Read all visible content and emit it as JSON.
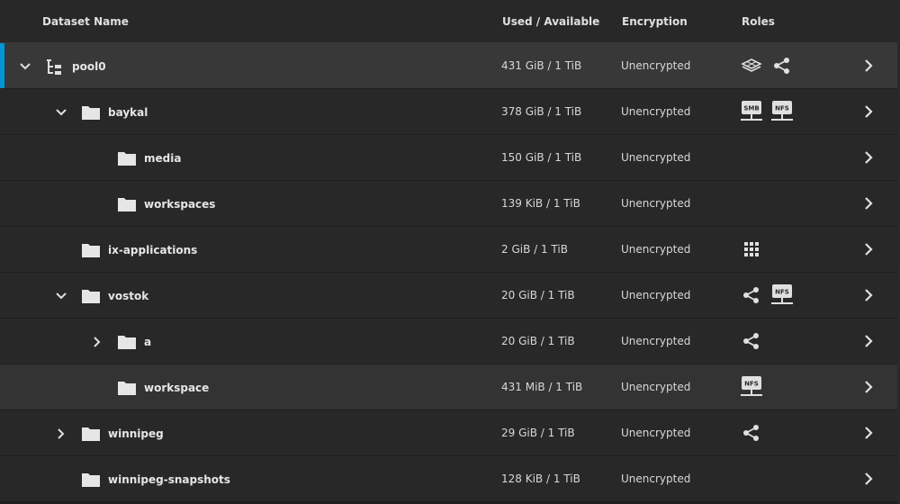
{
  "header": {
    "name": "Dataset Name",
    "used": "Used / Available",
    "encryption": "Encryption",
    "roles": "Roles"
  },
  "colors": {
    "accent": "#0095d5",
    "row": "#282828",
    "selected": "#383838",
    "icon": "#e0e0e0"
  },
  "rows": [
    {
      "name": "pool0",
      "used": "431 GiB / 1 TiB",
      "encryption": "Unencrypted",
      "toggle": "expanded",
      "icon": "pool-icon",
      "roles": [
        "stack-icon",
        "share-icon"
      ],
      "selected": true
    },
    {
      "name": "baykal",
      "used": "378 GiB / 1 TiB",
      "encryption": "Unencrypted",
      "toggle": "expanded",
      "icon": "folder-icon",
      "roles": [
        "smb-share-icon",
        "nfs-share-icon"
      ],
      "smb": "SMB",
      "nfs": "NFS"
    },
    {
      "name": "media",
      "used": "150 GiB / 1 TiB",
      "encryption": "Unencrypted",
      "toggle": "none",
      "icon": "folder-icon",
      "roles": []
    },
    {
      "name": "workspaces",
      "used": "139 KiB / 1 TiB",
      "encryption": "Unencrypted",
      "toggle": "none",
      "icon": "folder-icon",
      "roles": []
    },
    {
      "name": "ix-applications",
      "used": "2 GiB / 1 TiB",
      "encryption": "Unencrypted",
      "toggle": "none",
      "icon": "folder-icon",
      "roles": [
        "apps-icon"
      ]
    },
    {
      "name": "vostok",
      "used": "20 GiB / 1 TiB",
      "encryption": "Unencrypted",
      "toggle": "expanded",
      "icon": "folder-icon",
      "roles": [
        "share-icon",
        "nfs-share-icon"
      ],
      "nfs": "NFS"
    },
    {
      "name": "a",
      "used": "20 GiB / 1 TiB",
      "encryption": "Unencrypted",
      "toggle": "collapsed",
      "icon": "folder-icon",
      "roles": [
        "share-icon"
      ]
    },
    {
      "name": "workspace",
      "used": "431 MiB / 1 TiB",
      "encryption": "Unencrypted",
      "toggle": "none",
      "icon": "folder-icon",
      "roles": [
        "nfs-share-icon"
      ],
      "nfs": "NFS",
      "highlight": true
    },
    {
      "name": "winnipeg",
      "used": "29 GiB / 1 TiB",
      "encryption": "Unencrypted",
      "toggle": "collapsed",
      "icon": "folder-icon",
      "roles": [
        "share-icon"
      ]
    },
    {
      "name": "winnipeg-snapshots",
      "used": "128 KiB / 1 TiB",
      "encryption": "Unencrypted",
      "toggle": "none",
      "icon": "folder-icon",
      "roles": []
    }
  ]
}
